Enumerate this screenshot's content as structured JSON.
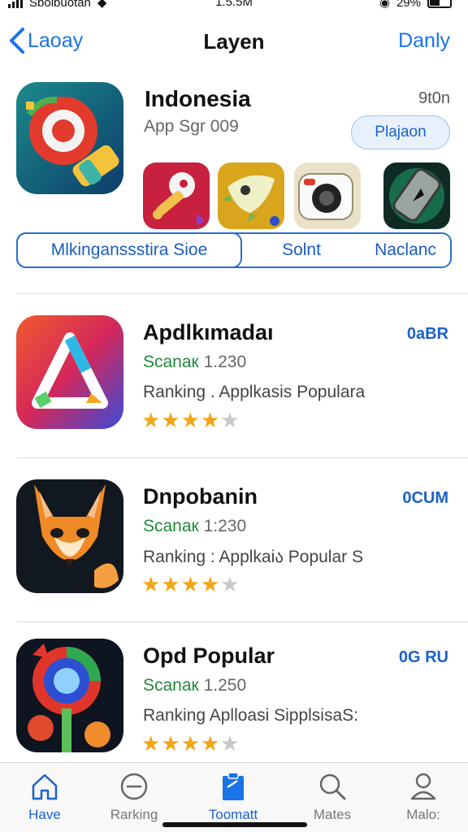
{
  "status_bar": {
    "carrier": "Sbolbuotan",
    "time": "1.5.5M",
    "battery": "29%"
  },
  "nav": {
    "back_label": "Laoay",
    "title": "Layen",
    "right_label": "Danly"
  },
  "featured": {
    "name": "Indonesia",
    "subtitle": "App Sgr 009",
    "size": "9t0n",
    "button_label": "Plajaon",
    "thumbnails": [
      "pin-app-icon",
      "bird-app-icon",
      "camera-app-icon",
      "phone-app-icon"
    ],
    "segments": [
      "Mlkinganssstira Sioe",
      "Solnt",
      "Naclanc"
    ]
  },
  "apps": [
    {
      "name": "Apdlkımadaı",
      "rating_label": "Scanaк",
      "rating_value": "1.230",
      "desc": "Ranking . Applkasis Populara",
      "stars": 4,
      "action": "0aBR",
      "icon": "triangle-app-icon"
    },
    {
      "name": "Dnpobanin",
      "rating_label": "Scanaк",
      "rating_value": "1:230",
      "desc": "Ranking : Applkaiა Popular S",
      "stars": 4,
      "action": "0CUM",
      "icon": "fox-app-icon"
    },
    {
      "name": "Opd Popular",
      "rating_label": "Scanaк",
      "rating_value": "1.250",
      "desc": "Ranking  Aplloasi SipplsisaS:",
      "stars": 4,
      "action": "0G RU",
      "icon": "orb-app-icon"
    }
  ],
  "tabs": [
    {
      "label": "Have",
      "icon": "home-icon",
      "active": false
    },
    {
      "label": "Rarking",
      "icon": "minus-circle-icon",
      "active": false
    },
    {
      "label": "Toomatt",
      "icon": "clipboard-icon",
      "active": true
    },
    {
      "label": "Mates",
      "icon": "search-icon",
      "active": false
    },
    {
      "label": "Malo:",
      "icon": "person-icon",
      "active": false
    }
  ],
  "colors": {
    "accent": "#1a73e8",
    "star": "#f2a516",
    "rating_green": "#1f8a3a"
  }
}
